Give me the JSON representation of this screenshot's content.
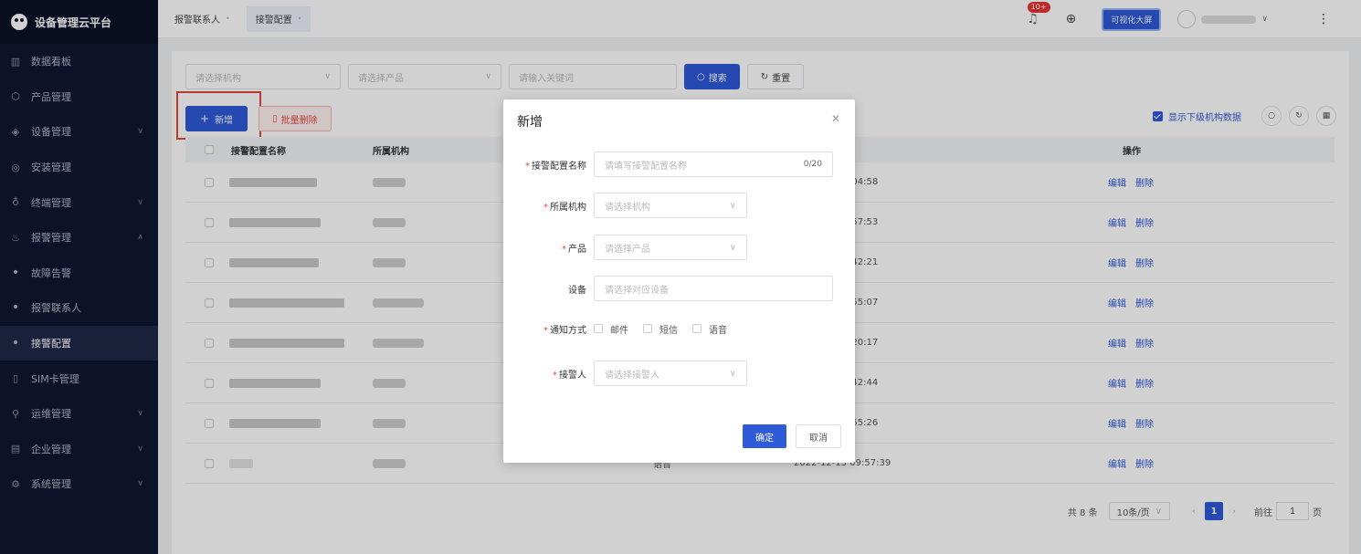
{
  "app": {
    "title": "设备管理云平台"
  },
  "sidebar": {
    "items": [
      {
        "label": "数据看板",
        "icon": "bar-chart-icon",
        "has_children": false
      },
      {
        "label": "产品管理",
        "icon": "cube-icon",
        "has_children": false
      },
      {
        "label": "设备管理",
        "icon": "layers-icon",
        "has_children": true
      },
      {
        "label": "安装管理",
        "icon": "install-icon",
        "has_children": false
      },
      {
        "label": "终端管理",
        "icon": "user-icon",
        "has_children": true
      },
      {
        "label": "报警管理",
        "icon": "alarm-icon",
        "has_children": true,
        "expanded": true
      },
      {
        "label": "故障告警",
        "sub": true
      },
      {
        "label": "报警联系人",
        "sub": true
      },
      {
        "label": "接警配置",
        "sub": true,
        "active": true
      },
      {
        "label": "SIM卡管理",
        "icon": "sim-icon",
        "has_children": false
      },
      {
        "label": "运维管理",
        "icon": "wrench-icon",
        "has_children": true
      },
      {
        "label": "企业管理",
        "icon": "building-icon",
        "has_children": true
      },
      {
        "label": "系统管理",
        "icon": "settings-icon",
        "has_children": true
      }
    ]
  },
  "tabs": [
    {
      "label": "报警联系人",
      "active": false
    },
    {
      "label": "接警配置",
      "active": true
    }
  ],
  "header": {
    "notification_badge": "10+",
    "screen_button": "可视化大屏"
  },
  "filters": {
    "org_placeholder": "请选择机构",
    "product_placeholder": "请选择产品",
    "keyword_placeholder": "请输入关键词",
    "search_label": "搜索",
    "reset_label": "重置"
  },
  "toolbar": {
    "add_label": "新增",
    "batch_delete_label": "批量删除",
    "show_sub_label": "显示下级机构数据"
  },
  "table": {
    "headers": {
      "name": "接警配置名称",
      "org": "所属机构",
      "ops": "操作"
    },
    "rows": [
      {
        "time": ":04:58"
      },
      {
        "time": ":57:53"
      },
      {
        "time": ":42:21"
      },
      {
        "time": ":55:07"
      },
      {
        "time": ":20:17"
      },
      {
        "time": ":42:44"
      },
      {
        "time": ":55:26"
      },
      {
        "time": "2022-12-15 09:57:39",
        "mode": "语音"
      }
    ],
    "edit_label": "编辑",
    "delete_label": "删除"
  },
  "pagination": {
    "total": "共 8 条",
    "page_size": "10条/页",
    "current_page": "1",
    "goto_prefix": "前往",
    "goto_value": "1",
    "goto_suffix": "页"
  },
  "modal": {
    "title": "新增",
    "fields": {
      "name_label": "接警配置名称",
      "name_placeholder": "请填写接警配置名称",
      "name_counter": "0/20",
      "org_label": "所属机构",
      "org_placeholder": "请选择机构",
      "product_label": "产品",
      "product_placeholder": "请选择产品",
      "device_label": "设备",
      "device_placeholder": "请选择对应设备",
      "notify_label": "通知方式",
      "notify_options": [
        "邮件",
        "短信",
        "语音"
      ],
      "receiver_label": "接警人",
      "receiver_placeholder": "请选择接警人"
    },
    "ok_label": "确定",
    "cancel_label": "取消"
  }
}
